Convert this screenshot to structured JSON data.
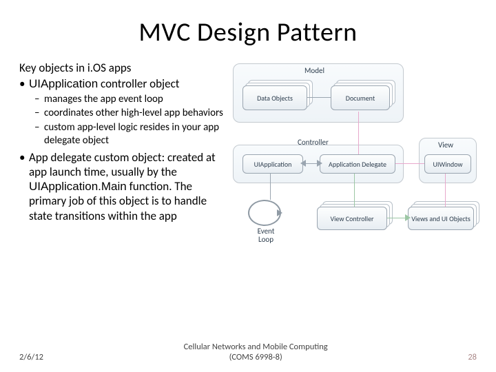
{
  "title": "MVC Design Pattern",
  "intro": "Key objects in i.OS apps",
  "bullets": {
    "b1a_code": "UIApplication",
    "b1a_rest": " controller object",
    "b1a_sub1": "manages the app event loop",
    "b1a_sub2": "coordinates other high-level app behaviors",
    "b1a_sub3": "custom app-level logic resides in your app delegate object",
    "b2_pre": "App delegate custom object: created at app launch time, usually by the ",
    "b2_code": "UIApplication.Main",
    "b2_post": " function. The primary job of this object is to handle state transitions within the app"
  },
  "diagram": {
    "model_label": "Model",
    "data_objects": "Data Objects",
    "document": "Document",
    "controller_label": "Controller",
    "uiapplication": "UIApplication",
    "app_delegate": "Application Delegate",
    "event_loop": "Event\nLoop",
    "view_label": "View",
    "uiwindow": "UIWindow",
    "view_controller": "View Controller",
    "views_ui": "Views and UI Objects"
  },
  "footer": {
    "date": "2/6/12",
    "center1": "Cellular Networks and Mobile Computing",
    "center2": "(COMS 6998-8)",
    "page": "28"
  }
}
